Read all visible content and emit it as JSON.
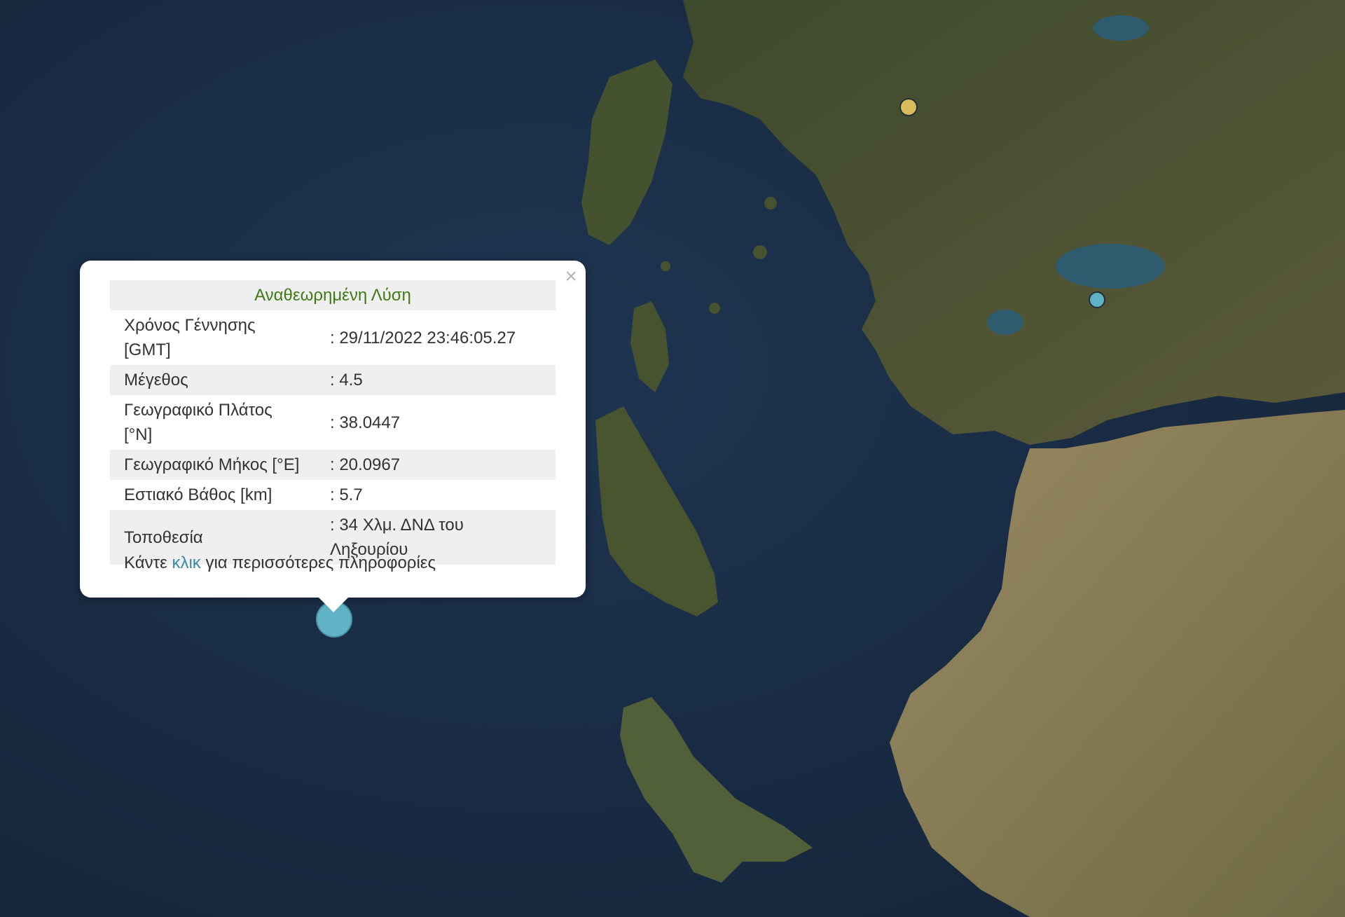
{
  "map": {
    "basemap": "satellite",
    "colors": {
      "sea": "#1c2f47",
      "land": "#4b5632",
      "plains": "#8f7f5c",
      "lake": "#2f5b6e"
    },
    "markers": [
      {
        "name": "selected-earthquake",
        "color": "#5fb3c4"
      },
      {
        "name": "earthquake-yellow",
        "color": "#d9bd5a"
      },
      {
        "name": "earthquake-cyan",
        "color": "#5fb3c4"
      }
    ]
  },
  "popup": {
    "title": "Αναθεωρημένη Λύση",
    "close_icon": "×",
    "rows": [
      {
        "label": "Χρόνος Γέννησης [GMT]",
        "value": ": 29/11/2022 23:46:05.27"
      },
      {
        "label": "Μέγεθος",
        "value": ": 4.5"
      },
      {
        "label": "Γεωγραφικό Πλάτος [°N]",
        "value": ": 38.0447"
      },
      {
        "label": "Γεωγραφικό Μήκος [°E]",
        "value": ": 20.0967"
      },
      {
        "label": "Εστιακό Βάθος [km]",
        "value": ": 5.7"
      },
      {
        "label": "Τοποθεσία",
        "value": ": 34 Χλμ. ΔΝΔ του Ληξουρίου"
      }
    ],
    "more_prefix": "Κάντε",
    "more_link": "κλικ",
    "more_suffix": "για περισσότερες πληροφορίες"
  }
}
